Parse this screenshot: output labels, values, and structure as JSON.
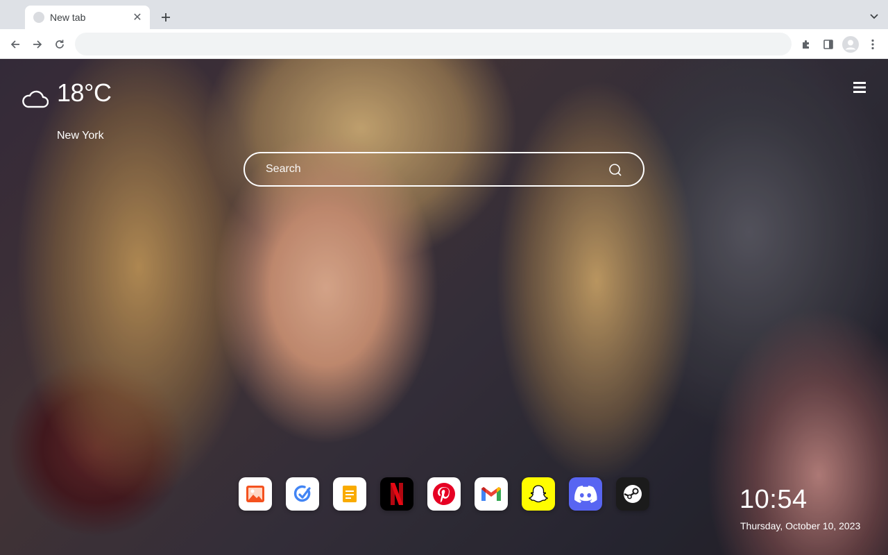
{
  "browser": {
    "tab": {
      "title": "New tab",
      "close_glyph": "✕"
    },
    "new_tab_glyph": "+",
    "omnibox": {
      "value": "",
      "placeholder": ""
    },
    "icons": [
      "back-icon",
      "forward-icon",
      "reload-icon",
      "extensions-icon",
      "side-panel-icon",
      "profile-icon",
      "more-icon",
      "tab-search-chevron-icon"
    ]
  },
  "weather": {
    "temperature": "18°C",
    "city": "New York",
    "icon": "cloud-icon"
  },
  "search": {
    "placeholder": "Search"
  },
  "apps": [
    {
      "name": "photos",
      "icon": "photos-icon",
      "bg": "#ffffff",
      "accent": "#f4511e"
    },
    {
      "name": "tasks",
      "icon": "tasks-icon",
      "bg": "#ffffff",
      "accent": "#4285f4"
    },
    {
      "name": "notes",
      "icon": "notes-icon",
      "bg": "#ffffff",
      "accent": "#f9ab00"
    },
    {
      "name": "netflix",
      "icon": "netflix-icon",
      "bg": "#000000",
      "accent": "#e50914"
    },
    {
      "name": "pinterest",
      "icon": "pinterest-icon",
      "bg": "#ffffff",
      "accent": "#e60023"
    },
    {
      "name": "gmail",
      "icon": "gmail-icon",
      "bg": "#ffffff",
      "accent": "#ea4335"
    },
    {
      "name": "snapchat",
      "icon": "snapchat-icon",
      "bg": "#fffc00",
      "accent": "#ffffff"
    },
    {
      "name": "discord",
      "icon": "discord-icon",
      "bg": "#5865f2",
      "accent": "#ffffff"
    },
    {
      "name": "steam",
      "icon": "steam-icon",
      "bg": "#1b1b1b",
      "accent": "#ffffff"
    }
  ],
  "clock": {
    "time": "10:54",
    "date": "Thursday, October 10, 2023"
  },
  "colors": {
    "tabstrip_bg": "#dee1e6",
    "toolbar_bg": "#ffffff",
    "omnibox_bg": "#f1f3f4",
    "overlay_text": "#ffffff"
  }
}
